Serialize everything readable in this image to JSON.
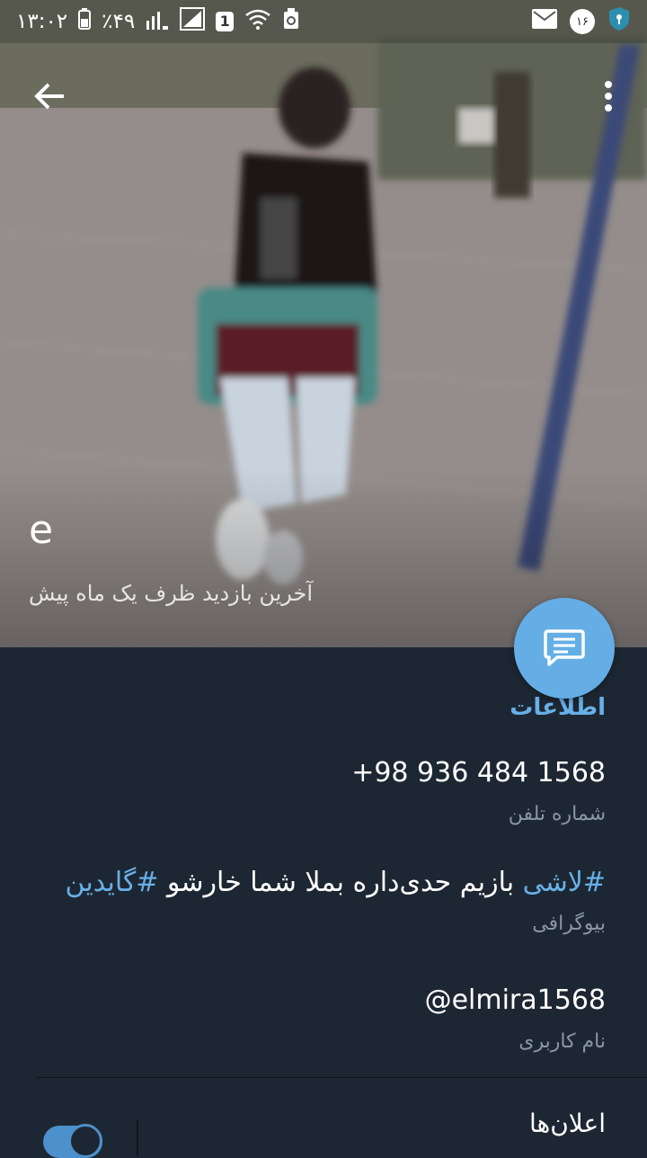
{
  "status_bar": {
    "time": "۱۳:۰۲",
    "battery_percent": "٪۴۹",
    "sim_slot": "1",
    "notification_count": "۱۶",
    "icons": [
      "battery-icon",
      "signal-icon",
      "sim-icon",
      "wifi-icon",
      "recycle-icon",
      "mail-icon",
      "badge-icon",
      "shield-icon"
    ]
  },
  "header": {
    "profile_name": "e",
    "last_seen": "آخرین بازدید ظرف یک ماه پیش",
    "back_icon": "arrow-left-icon",
    "menu_icon": "more-vertical-icon",
    "message_icon": "chat-bubble-icon"
  },
  "info": {
    "section_title": "اطلاعات",
    "phone": {
      "value": "+98 936 484 1568",
      "label": "شماره تلفن"
    },
    "bio": {
      "tag1": "#لاشی",
      "text": " بازیم حدی‌داره بملا شما خارشو ",
      "tag2": "#گایدین",
      "label": "بیوگرافی"
    },
    "username": {
      "value": "@elmira1568",
      "label": "نام کاربری"
    }
  },
  "notifications": {
    "label": "اعلان‌ها",
    "enabled": true
  },
  "colors": {
    "accent": "#64aee5",
    "link": "#68b0e8",
    "background": "#1d2733",
    "secondary_text": "#8a96a4"
  }
}
